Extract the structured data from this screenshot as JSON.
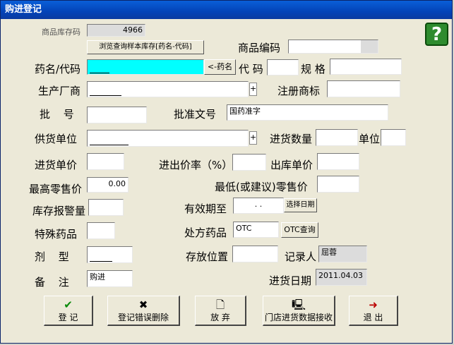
{
  "window": {
    "title": "购进登记"
  },
  "stock_qty": {
    "label": "商品库存码",
    "value": "4966"
  },
  "browse_button": "浏览查询样本库存[药名-代码]",
  "product_code": {
    "label": "商品编码",
    "value": ""
  },
  "drug_name": {
    "label": "药名/代码",
    "value": "",
    "button": "<-药名"
  },
  "code": {
    "label": "代 码",
    "value": ""
  },
  "spec": {
    "label": "规 格",
    "value": ""
  },
  "manufacturer": {
    "label": "生产厂商",
    "value": "",
    "plus": "+"
  },
  "trademark": {
    "label": "注册商标",
    "value": ""
  },
  "batch_no": {
    "label": "批   号",
    "value": ""
  },
  "approval_no": {
    "label": "批准文号",
    "value": "国药准字"
  },
  "supplier": {
    "label": "供货单位",
    "value": "",
    "plus": "+"
  },
  "purchase_qty": {
    "label": "进货数量",
    "value": ""
  },
  "unit": {
    "label": "单位",
    "value": ""
  },
  "purchase_price": {
    "label": "进货单价",
    "value": ""
  },
  "markup_rate": {
    "label": "进出价率（%）",
    "value": ""
  },
  "outbound_price": {
    "label": "出库单价",
    "value": ""
  },
  "max_retail": {
    "label": "最高零售价",
    "value": "0.00"
  },
  "min_retail": {
    "label": "最低(或建议)零售价",
    "value": ""
  },
  "stock_alert": {
    "label": "库存报警量",
    "value": ""
  },
  "expiry": {
    "label": "有效期至",
    "value": ".   .",
    "button": "选择日期"
  },
  "special_drug": {
    "label": "特殊药品",
    "value": ""
  },
  "prescription": {
    "label": "处方药品",
    "value": "OTC",
    "button": "OTC查询"
  },
  "dosage_form": {
    "label": "剂   型",
    "value": ""
  },
  "storage": {
    "label": "存放位置",
    "value": ""
  },
  "recorder": {
    "label": "记录人",
    "value": "屈蓉"
  },
  "remark": {
    "label": "备   注",
    "value": "购进"
  },
  "purchase_date": {
    "label": "进货日期",
    "value": "2011.04.03"
  },
  "buttons": {
    "register": "登 记",
    "delete_error": "登记错误删除",
    "discard": "放 弃",
    "receive": "门店进货数据接收",
    "exit": "退  出"
  },
  "help_icon": "?"
}
